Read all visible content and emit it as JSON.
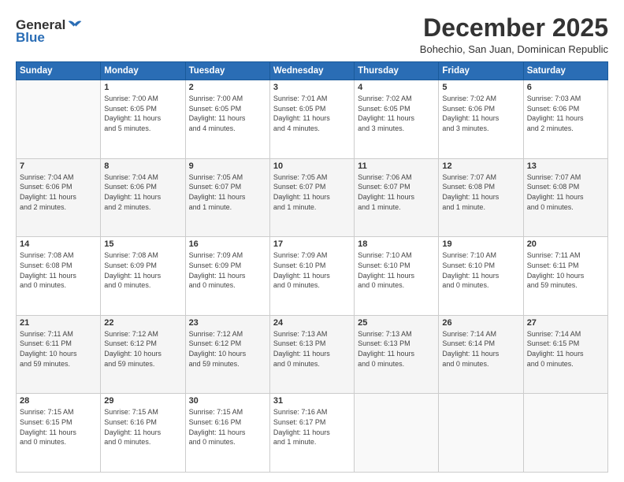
{
  "header": {
    "logo_general": "General",
    "logo_blue": "Blue",
    "month_title": "December 2025",
    "location": "Bohechio, San Juan, Dominican Republic"
  },
  "days_of_week": [
    "Sunday",
    "Monday",
    "Tuesday",
    "Wednesday",
    "Thursday",
    "Friday",
    "Saturday"
  ],
  "weeks": [
    [
      {
        "day": "",
        "info": ""
      },
      {
        "day": "1",
        "info": "Sunrise: 7:00 AM\nSunset: 6:05 PM\nDaylight: 11 hours\nand 5 minutes."
      },
      {
        "day": "2",
        "info": "Sunrise: 7:00 AM\nSunset: 6:05 PM\nDaylight: 11 hours\nand 4 minutes."
      },
      {
        "day": "3",
        "info": "Sunrise: 7:01 AM\nSunset: 6:05 PM\nDaylight: 11 hours\nand 4 minutes."
      },
      {
        "day": "4",
        "info": "Sunrise: 7:02 AM\nSunset: 6:05 PM\nDaylight: 11 hours\nand 3 minutes."
      },
      {
        "day": "5",
        "info": "Sunrise: 7:02 AM\nSunset: 6:06 PM\nDaylight: 11 hours\nand 3 minutes."
      },
      {
        "day": "6",
        "info": "Sunrise: 7:03 AM\nSunset: 6:06 PM\nDaylight: 11 hours\nand 2 minutes."
      }
    ],
    [
      {
        "day": "7",
        "info": "Sunrise: 7:04 AM\nSunset: 6:06 PM\nDaylight: 11 hours\nand 2 minutes."
      },
      {
        "day": "8",
        "info": "Sunrise: 7:04 AM\nSunset: 6:06 PM\nDaylight: 11 hours\nand 2 minutes."
      },
      {
        "day": "9",
        "info": "Sunrise: 7:05 AM\nSunset: 6:07 PM\nDaylight: 11 hours\nand 1 minute."
      },
      {
        "day": "10",
        "info": "Sunrise: 7:05 AM\nSunset: 6:07 PM\nDaylight: 11 hours\nand 1 minute."
      },
      {
        "day": "11",
        "info": "Sunrise: 7:06 AM\nSunset: 6:07 PM\nDaylight: 11 hours\nand 1 minute."
      },
      {
        "day": "12",
        "info": "Sunrise: 7:07 AM\nSunset: 6:08 PM\nDaylight: 11 hours\nand 1 minute."
      },
      {
        "day": "13",
        "info": "Sunrise: 7:07 AM\nSunset: 6:08 PM\nDaylight: 11 hours\nand 0 minutes."
      }
    ],
    [
      {
        "day": "14",
        "info": "Sunrise: 7:08 AM\nSunset: 6:08 PM\nDaylight: 11 hours\nand 0 minutes."
      },
      {
        "day": "15",
        "info": "Sunrise: 7:08 AM\nSunset: 6:09 PM\nDaylight: 11 hours\nand 0 minutes."
      },
      {
        "day": "16",
        "info": "Sunrise: 7:09 AM\nSunset: 6:09 PM\nDaylight: 11 hours\nand 0 minutes."
      },
      {
        "day": "17",
        "info": "Sunrise: 7:09 AM\nSunset: 6:10 PM\nDaylight: 11 hours\nand 0 minutes."
      },
      {
        "day": "18",
        "info": "Sunrise: 7:10 AM\nSunset: 6:10 PM\nDaylight: 11 hours\nand 0 minutes."
      },
      {
        "day": "19",
        "info": "Sunrise: 7:10 AM\nSunset: 6:10 PM\nDaylight: 11 hours\nand 0 minutes."
      },
      {
        "day": "20",
        "info": "Sunrise: 7:11 AM\nSunset: 6:11 PM\nDaylight: 10 hours\nand 59 minutes."
      }
    ],
    [
      {
        "day": "21",
        "info": "Sunrise: 7:11 AM\nSunset: 6:11 PM\nDaylight: 10 hours\nand 59 minutes."
      },
      {
        "day": "22",
        "info": "Sunrise: 7:12 AM\nSunset: 6:12 PM\nDaylight: 10 hours\nand 59 minutes."
      },
      {
        "day": "23",
        "info": "Sunrise: 7:12 AM\nSunset: 6:12 PM\nDaylight: 10 hours\nand 59 minutes."
      },
      {
        "day": "24",
        "info": "Sunrise: 7:13 AM\nSunset: 6:13 PM\nDaylight: 11 hours\nand 0 minutes."
      },
      {
        "day": "25",
        "info": "Sunrise: 7:13 AM\nSunset: 6:13 PM\nDaylight: 11 hours\nand 0 minutes."
      },
      {
        "day": "26",
        "info": "Sunrise: 7:14 AM\nSunset: 6:14 PM\nDaylight: 11 hours\nand 0 minutes."
      },
      {
        "day": "27",
        "info": "Sunrise: 7:14 AM\nSunset: 6:15 PM\nDaylight: 11 hours\nand 0 minutes."
      }
    ],
    [
      {
        "day": "28",
        "info": "Sunrise: 7:15 AM\nSunset: 6:15 PM\nDaylight: 11 hours\nand 0 minutes."
      },
      {
        "day": "29",
        "info": "Sunrise: 7:15 AM\nSunset: 6:16 PM\nDaylight: 11 hours\nand 0 minutes."
      },
      {
        "day": "30",
        "info": "Sunrise: 7:15 AM\nSunset: 6:16 PM\nDaylight: 11 hours\nand 0 minutes."
      },
      {
        "day": "31",
        "info": "Sunrise: 7:16 AM\nSunset: 6:17 PM\nDaylight: 11 hours\nand 1 minute."
      },
      {
        "day": "",
        "info": ""
      },
      {
        "day": "",
        "info": ""
      },
      {
        "day": "",
        "info": ""
      }
    ]
  ]
}
